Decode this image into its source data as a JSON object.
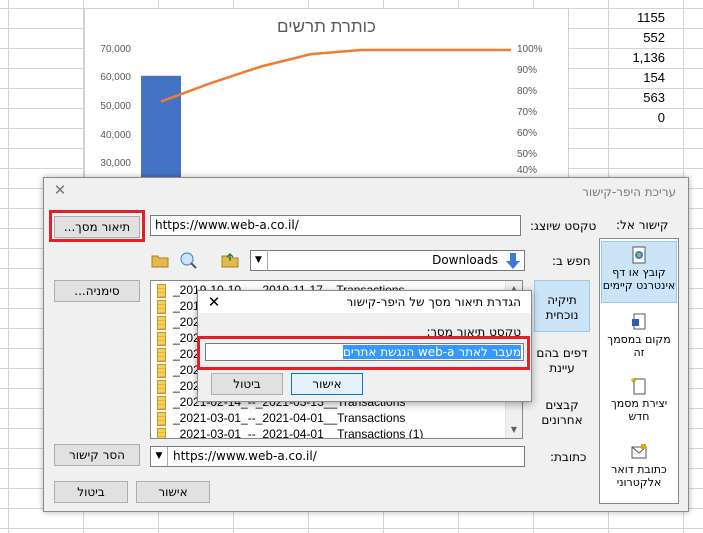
{
  "spreadsheet": {
    "cells": [
      "1155",
      "552",
      "1,136",
      "154",
      "563",
      "0"
    ]
  },
  "chart_data": {
    "type": "bar",
    "title": "כותרת תרשים",
    "y_left_ticks": [
      "70,000",
      "60,000",
      "50,000",
      "40,000",
      "30,000"
    ],
    "y_right_ticks": [
      "100%",
      "90%",
      "80%",
      "70%",
      "60%",
      "50%",
      "40%"
    ],
    "ylim": [
      25000,
      70000
    ],
    "y2lim": [
      37.5,
      100
    ],
    "bar_values": [
      61000
    ],
    "bar_color": "#4472c4",
    "line_values": [
      75,
      84,
      92,
      98,
      100,
      100,
      100,
      100
    ],
    "line_color": "#ed7d31"
  },
  "dialog": {
    "title": "עריכת היפר-קישור",
    "link_to_label": "קישור אל:",
    "text_to_display_label": "טקסט שיוצג:",
    "text_to_display_value": "https://www.web-a.co.il/",
    "screen_tip_button": "תיאור מסך...",
    "look_in_label": "חפש ב:",
    "look_in_value": "Downloads",
    "bookmark_button": "סימניה...",
    "address_label": "כתובת:",
    "address_value": "https://www.web-a.co.il/",
    "remove_link_button": "הסר קישור",
    "ok_button": "אישור",
    "cancel_button": "ביטול",
    "side_tabs": [
      "תיקיה נוכחית",
      "דפים בהם עיינת",
      "קבצים אחרונים"
    ],
    "link_to_items": [
      "קובץ או דף אינטרנט קיימים",
      "מקום במסמך זה",
      "יצירת מסמך חדש",
      "כתובת דואר אלקטרוני"
    ],
    "files": [
      "_2019-10-10_--_2019-11-17__Transactions",
      "_2019-",
      "_2020-",
      "_2020-",
      "_2020-",
      "_2020-",
      "_2021-",
      "_2021-02-14_--_2021-03-13__Transactions",
      "_2021-03-01_--_2021-04-01__Transactions",
      "_2021-03-01_--_2021-04-01__Transactions (1)"
    ]
  },
  "screen_tip_dialog": {
    "title": "הגדרת תיאור מסך של היפר-קישור",
    "field_label": "טקסט תיאור מסך:",
    "field_value": "מעבר לאתר web-a הנגשת אתרים",
    "ok_button": "אישור",
    "cancel_button": "ביטול"
  }
}
